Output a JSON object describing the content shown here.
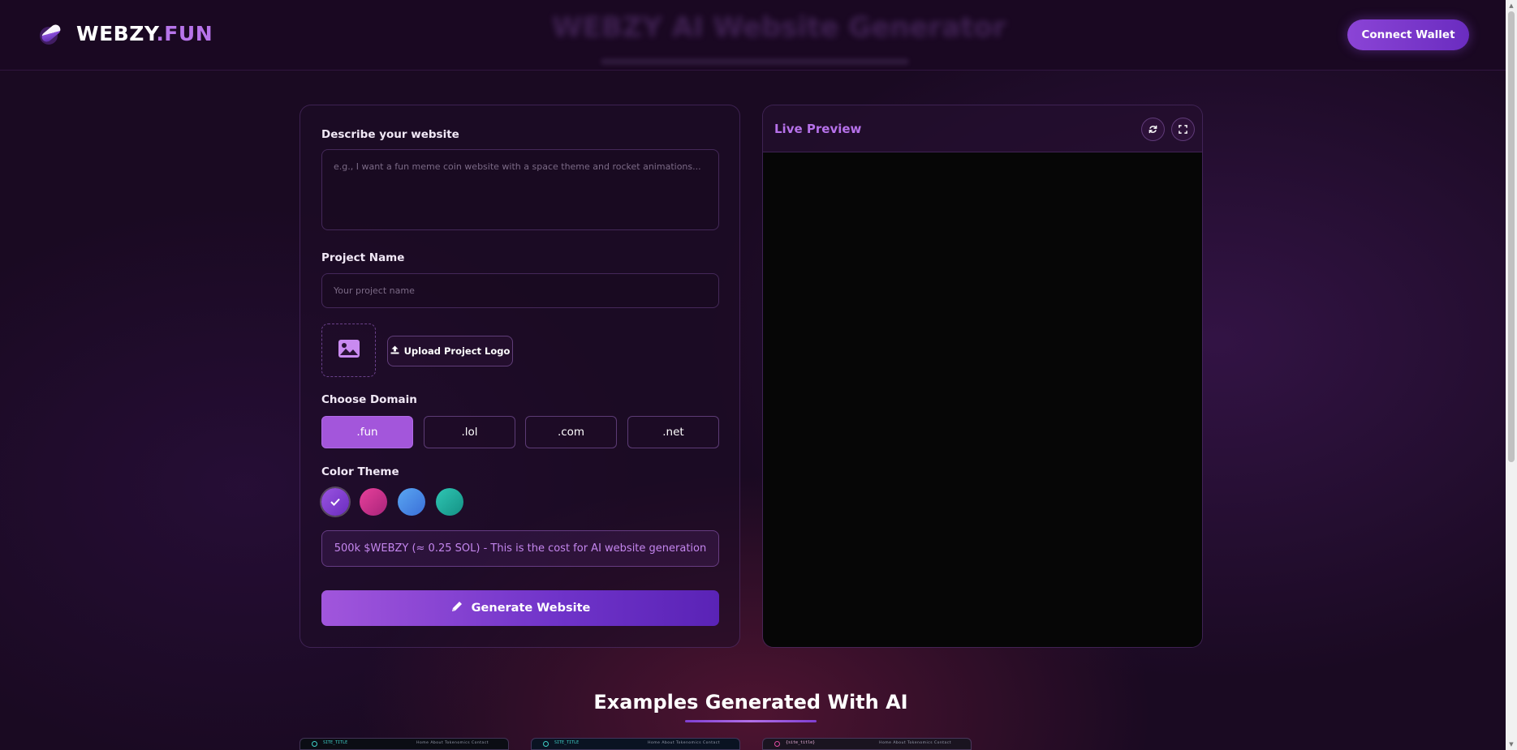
{
  "header": {
    "brand_main": "WEBZY",
    "brand_accent": ".FUN",
    "ghost_title": "WEBZY AI Website Generator",
    "connect_label": "Connect Wallet"
  },
  "form": {
    "describe_label": "Describe your website",
    "describe_placeholder": "e.g., I want a fun meme coin website with a space theme and rocket animations...",
    "project_label": "Project Name",
    "project_placeholder": "Your project name",
    "upload_label": "Upload Project Logo",
    "domain_label": "Choose Domain",
    "domains": [
      ".fun",
      ".lol",
      ".com",
      ".net"
    ],
    "selected_domain": ".fun",
    "color_label": "Color Theme",
    "themes": [
      {
        "name": "purple",
        "color": "#8a44d8",
        "selected": true
      },
      {
        "name": "pink",
        "color": "#d3358f",
        "selected": false
      },
      {
        "name": "blue",
        "color": "#4a90e8",
        "selected": false
      },
      {
        "name": "teal",
        "color": "#1fb3a4",
        "selected": false
      }
    ],
    "cost_text": "500k $WEBZY (≈ 0.25 SOL) - This is the cost for AI website generation",
    "generate_label": "Generate Website"
  },
  "preview": {
    "title": "Live Preview"
  },
  "examples": {
    "title": "Examples Generated With AI",
    "thumbs": [
      {
        "title": "SITE_TITLE",
        "nav": "Home  About  Tokenomics  Contact"
      },
      {
        "title": "SITE_TITLE",
        "nav": "Home  About  Tokenomics  Contact"
      },
      {
        "title": "{site_title}",
        "nav": "Home  About  Tokenomics  Contact"
      }
    ]
  },
  "colors": {
    "accent": "#b774ea",
    "background": "#1a0a22"
  }
}
